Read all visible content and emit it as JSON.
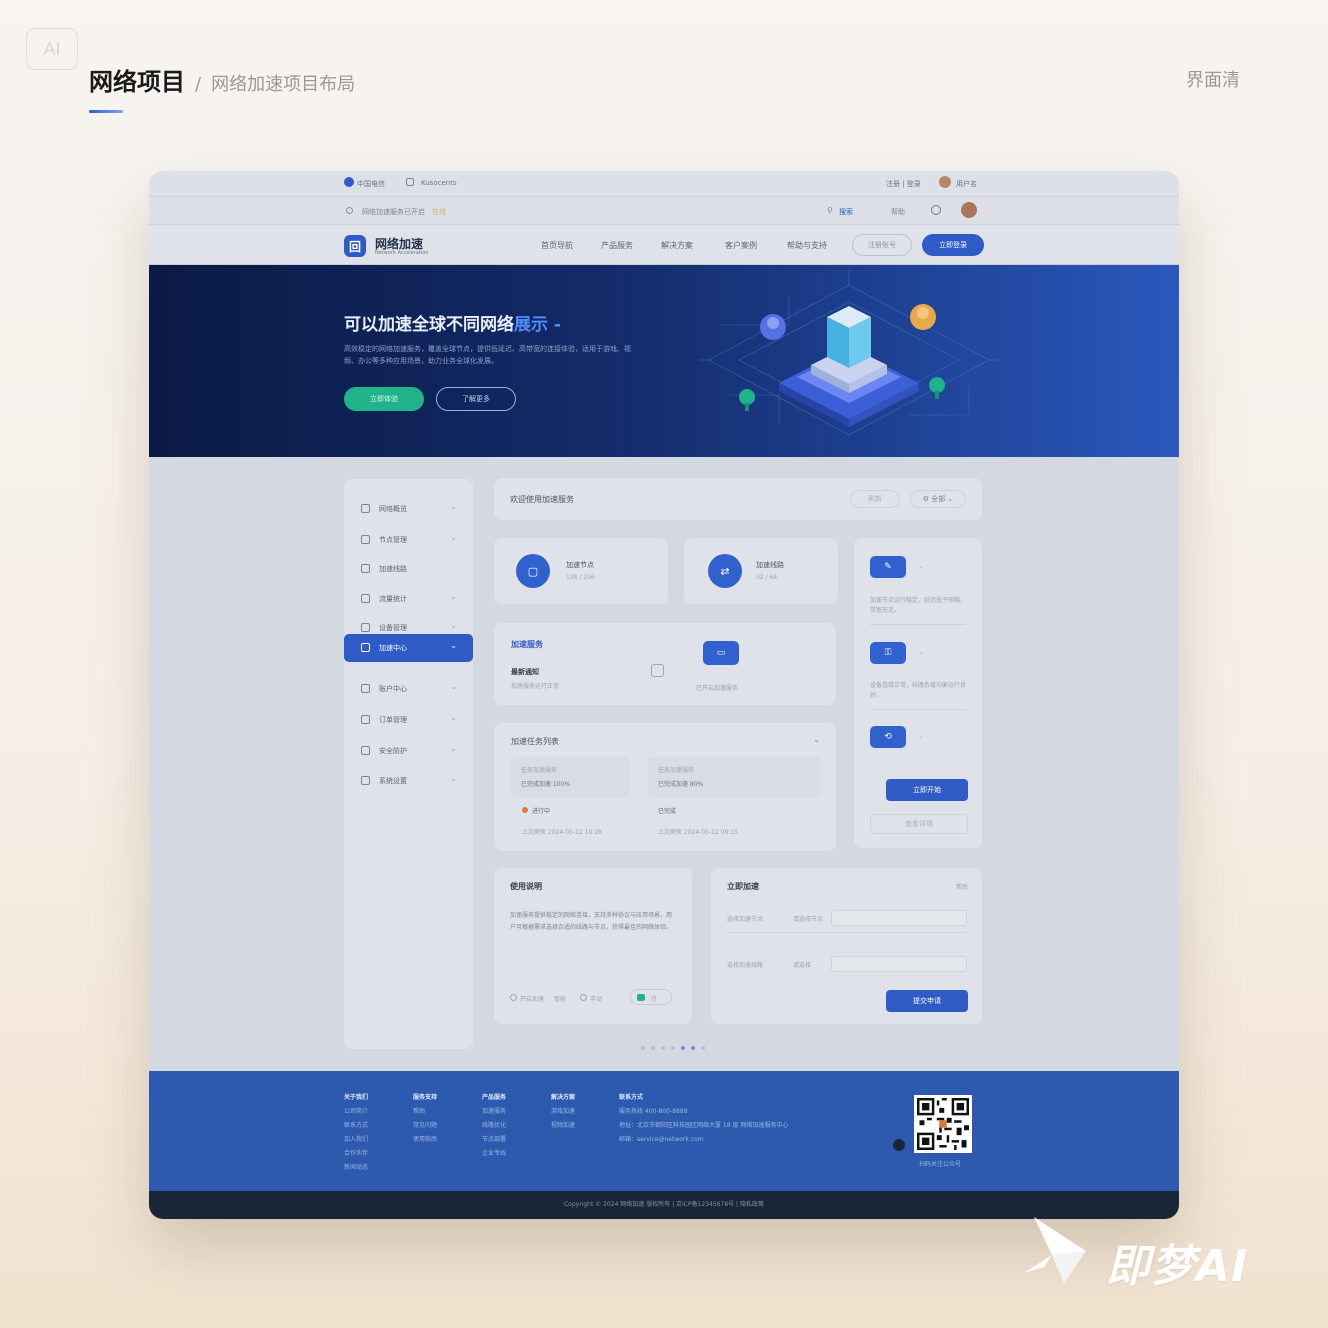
{
  "page": {
    "badge": "AI",
    "title": "网络项目",
    "separator": "/",
    "subtitle": "网络加速项目布局",
    "right_label": "界面清"
  },
  "mockup": {
    "topbar": {
      "brand": "中国电信",
      "tab": "Kusocents",
      "right_text": "注册 | 登录",
      "user": "用户名"
    },
    "subbar": {
      "notice": "网络加速服务已开启",
      "status": "在线",
      "search": "搜索",
      "link1": "帮助",
      "link2": "设置"
    },
    "nav": {
      "logo_mark": "回",
      "logo": "网络加速",
      "logo_sub": "Network Acceleration",
      "items": [
        "首页导航",
        "产品服务",
        "解决方案",
        "客户案例",
        "帮助与支持"
      ],
      "btn_outline": "注册账号",
      "btn_fill": "立即登录"
    },
    "hero": {
      "title_main": "可以加速全球不同网络",
      "title_highlight": "展示 -",
      "desc": "高效稳定的网络加速服务，覆盖全球节点，提供低延迟、高带宽的连接体验，适用于游戏、视频、办公等多种应用场景，助力业务全球化发展。",
      "btn_primary": "立即体验",
      "btn_secondary": "了解更多"
    },
    "sidebar": {
      "items": [
        "网络概览",
        "节点管理",
        "加速线路",
        "流量统计",
        "设备管理",
        "加速中心",
        "账户中心",
        "订单管理",
        "安全防护",
        "系统设置"
      ],
      "active_index": 5
    },
    "main": {
      "header_title": "欢迎使用加速服务",
      "header_btn": "刷新",
      "header_select": "全部",
      "stat1_title": "加速节点",
      "stat1_value": "128 / 256",
      "stat2_title": "加速线路",
      "stat2_value": "32 / 64",
      "notify_title": "加速服务",
      "notify_sub": "最新通知",
      "notify_desc": "加速服务运行正常",
      "notify_right": "已开启加速服务",
      "list_title": "加速任务列表",
      "task1_title": "任务加速服务",
      "task1_line": "已完成加速 100%",
      "task1_tag": "进行中",
      "task1_note": "上次更新 2024-05-12 10:28",
      "task2_title": "任务加速服务",
      "task2_line": "已完成加速 80%",
      "task2_tag": "已完成",
      "task2_note": "上次更新 2024-05-12 09:15"
    },
    "rightpanel": {
      "item1": "加速节点运行稳定，延迟低于预期，带宽充足。",
      "item2": "设备连接正常，线路负载均衡运行良好。",
      "btn_primary": "立即开始",
      "btn_secondary": "查看详情"
    },
    "detail": {
      "title": "使用说明",
      "text": "加速服务提供稳定的网络连接，支持多种协议与应用场景。用户可根据需求选择合适的线路与节点，获得最佳的网络体验。",
      "opt1": "开启加速",
      "opt2": "智能",
      "opt3": "手动",
      "toggle": "开"
    },
    "form": {
      "title": "立即加速",
      "tag": "帮助",
      "label1": "选择加速节点",
      "hint1": "请选择节点",
      "label2": "选择加速线路",
      "hint2": "请选择",
      "submit": "提交申请"
    },
    "footer": {
      "cols": [
        {
          "head": "关于我们",
          "items": [
            "公司简介",
            "联系方式",
            "加入我们",
            "合作伙伴",
            "新闻动态"
          ]
        },
        {
          "head": "服务支持",
          "items": [
            "帮助",
            "常见问题",
            "使用指南"
          ]
        },
        {
          "head": "产品服务",
          "items": [
            "加速服务",
            "线路优化",
            "节点部署",
            "企业专线"
          ]
        },
        {
          "head": "解决方案",
          "items": [
            "游戏加速",
            "视频加速"
          ]
        },
        {
          "head": "联系方式",
          "items": [
            "服务热线 400-800-8888",
            "地址：北京市朝阳区科技园区网络大厦 18 层 网络加速服务中心",
            "邮箱：service@network.com"
          ]
        }
      ],
      "qr_caption": "扫码关注公众号",
      "copyright": "Copyright © 2024 网络加速 版权所有 | 京ICP备12345678号 | 隐私政策"
    }
  },
  "watermark": "即梦AI"
}
